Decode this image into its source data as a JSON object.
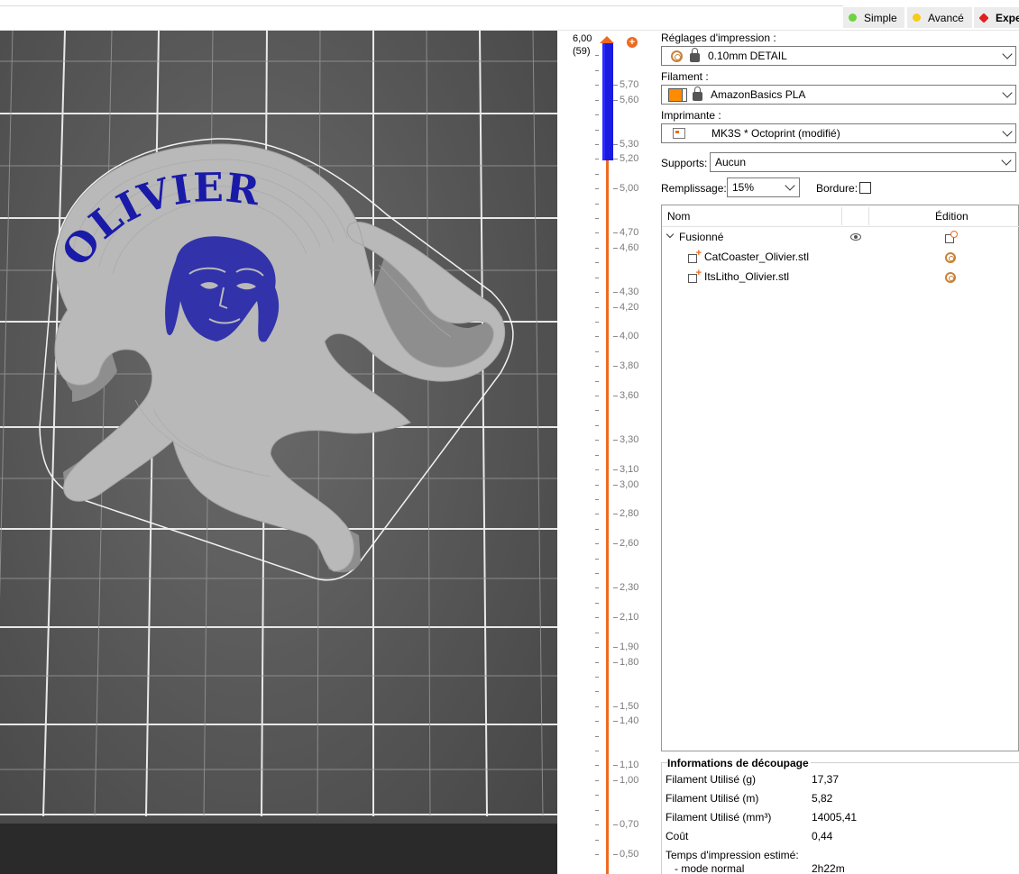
{
  "modes": {
    "simple": "Simple",
    "avance": "Avancé",
    "expert": "Expe",
    "colors": {
      "simple": "#6bd33f",
      "avance": "#f5cc16",
      "expert": "#e02020"
    }
  },
  "viewport": {
    "model_text": "OLIVIER",
    "text_color": "#1a1aa8"
  },
  "slider": {
    "top_value": "6,00",
    "top_layer": "(59)",
    "ticks": [
      "5,70",
      "5,60",
      "5,30",
      "5,20",
      "5,00",
      "4,70",
      "4,60",
      "4,30",
      "4,20",
      "4,00",
      "3,80",
      "3,60",
      "3,30",
      "3,10",
      "3,00",
      "2,80",
      "2,60",
      "2,30",
      "2,10",
      "1,90",
      "1,80",
      "1,50",
      "1,40",
      "1,10",
      "1,00",
      "0,70",
      "0,50"
    ],
    "accent": "#ed6b21",
    "range_color": "#1a1ae0"
  },
  "settings": {
    "print_label": "Réglages d'impression :",
    "print_value": "0.10mm DETAIL",
    "filament_label": "Filament :",
    "filament_value": "AmazonBasics PLA",
    "filament_color": "#ff8c00",
    "printer_label": "Imprimante :",
    "printer_value": "MK3S * Octoprint (modifié)",
    "supports_label": "Supports:",
    "supports_value": "Aucun",
    "infill_label": "Remplissage:",
    "infill_value": "15%",
    "brim_label": "Bordure:"
  },
  "objects": {
    "col_name": "Nom",
    "col_edit": "Édition",
    "group": "Fusionné",
    "items": [
      "CatCoaster_Olivier.stl",
      "ItsLitho_Olivier.stl"
    ]
  },
  "slice_info": {
    "title": "Informations de découpage",
    "rows": [
      {
        "k": "Filament Utilisé (g)",
        "v": "17,37"
      },
      {
        "k": "Filament Utilisé (m)",
        "v": "5,82"
      },
      {
        "k": "Filament Utilisé (mm³)",
        "v": "14005,41"
      },
      {
        "k": "Coût",
        "v": "0,44"
      },
      {
        "k": "Temps d'impression estimé:",
        "v": ""
      },
      {
        "k": "  - mode normal",
        "v": "2h22m"
      }
    ]
  }
}
